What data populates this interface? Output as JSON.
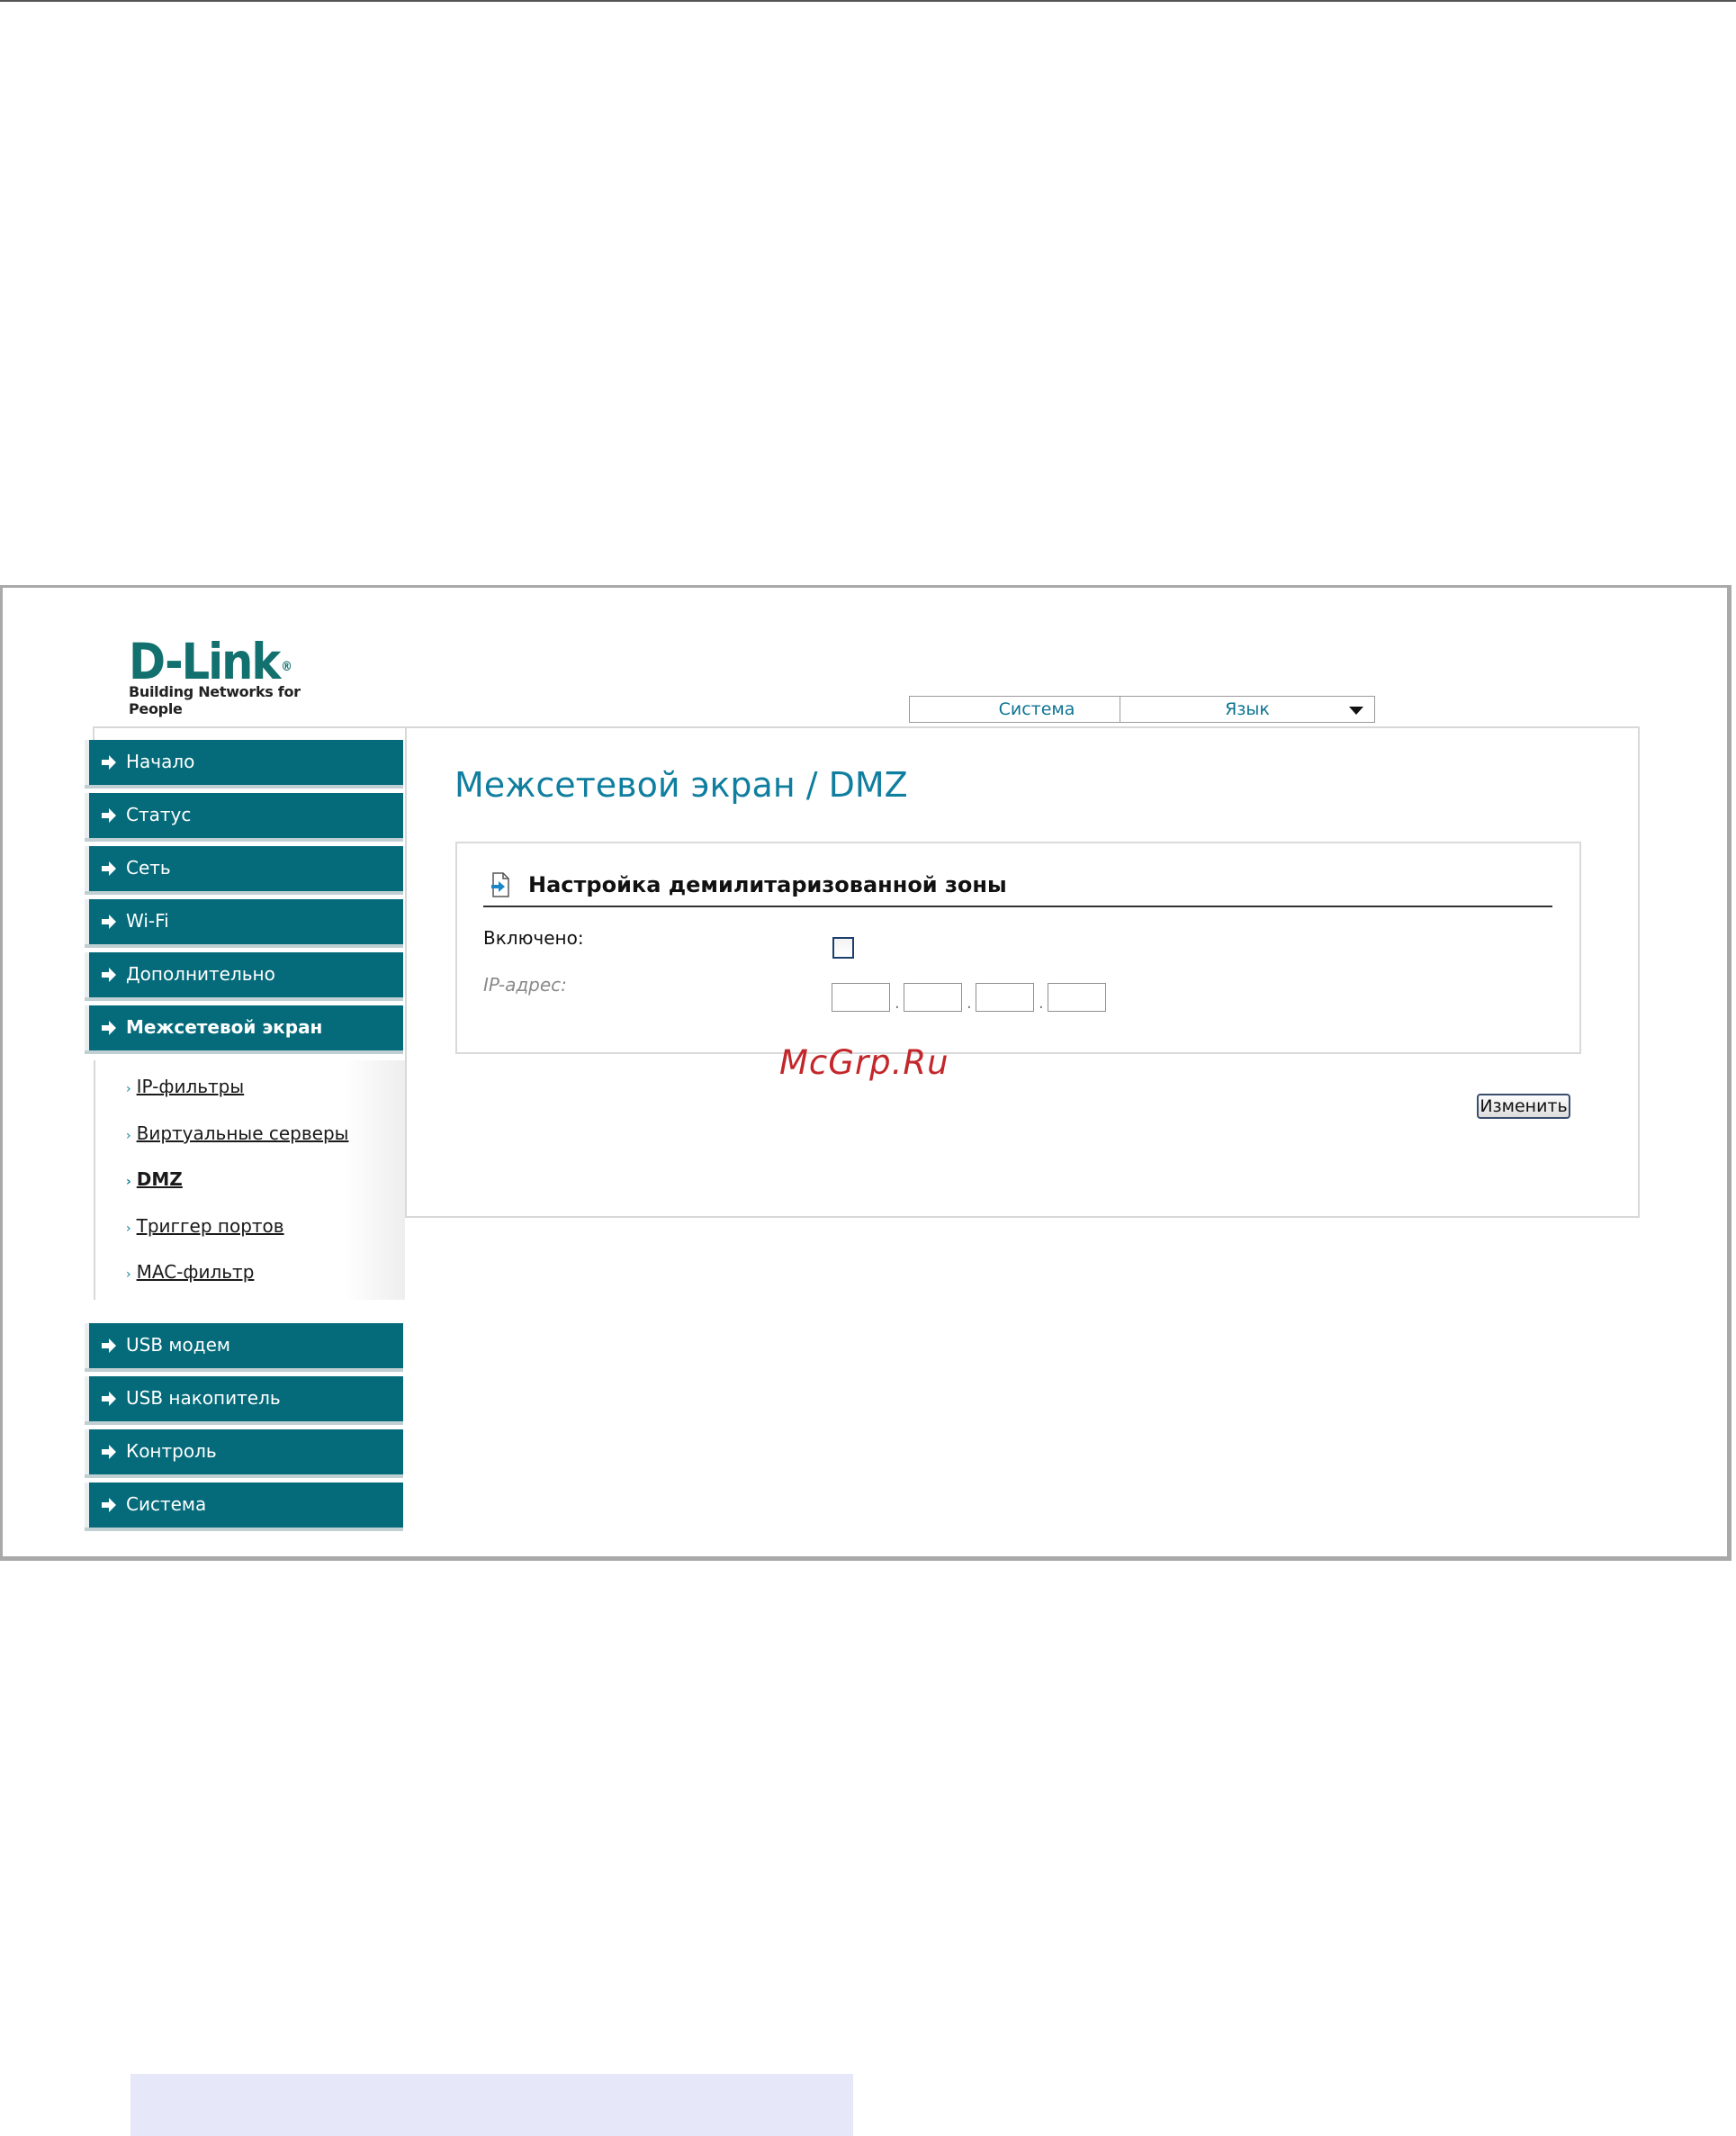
{
  "logo": {
    "brand": "D-Link",
    "registered": "®",
    "tagline": "Building Networks for People"
  },
  "top_menu": {
    "system": "Система",
    "language": "Язык"
  },
  "sidebar": {
    "items": [
      {
        "label": "Начало"
      },
      {
        "label": "Статус"
      },
      {
        "label": "Сеть"
      },
      {
        "label": "Wi-Fi"
      },
      {
        "label": "Дополнительно"
      },
      {
        "label": "Межсетевой экран"
      },
      {
        "label": "USB модем"
      },
      {
        "label": "USB накопитель"
      },
      {
        "label": "Контроль"
      },
      {
        "label": "Система"
      }
    ],
    "submenu": [
      {
        "label": "IP-фильтры"
      },
      {
        "label": "Виртуальные серверы"
      },
      {
        "label": "DMZ"
      },
      {
        "label": "Триггер портов"
      },
      {
        "label": "MAC-фильтр"
      }
    ],
    "active_item": "Межсетевой экран",
    "active_subitem": "DMZ"
  },
  "main": {
    "title": "Межсетевой экран / DMZ",
    "section_title": "Настройка демилитаризованной зоны",
    "enabled_label": "Включено:",
    "enabled_checked": false,
    "ip_label": "IP-адрес:",
    "ip_octets": [
      "",
      "",
      "",
      ""
    ],
    "ip_separator": ".",
    "apply_button": "Изменить"
  },
  "watermark": "McGrp.Ru",
  "colors": {
    "nav_bg": "#056b7b",
    "title": "#0f7e9f",
    "watermark": "#c3272b"
  }
}
